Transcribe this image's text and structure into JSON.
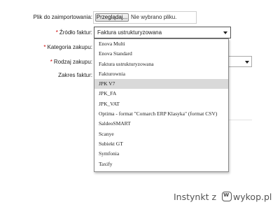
{
  "form": {
    "file_label": "Plik do zaimportowania:",
    "browse_button": "Przeglądaj...",
    "file_status": "Nie wybrano pliku.",
    "source_label": "Źródło faktur:",
    "source_value": "Faktura ustrukturyzowana",
    "category_label": "Kategoria zakupu:",
    "type_label": "Rodzaj zakupu:",
    "range_label": "Zakres faktur:",
    "required_mark": "*"
  },
  "dropdown": {
    "highlighted_index": 4,
    "options": [
      "Enova Multi",
      "Enova Standard",
      "Faktura ustrukturyzowana",
      "Fakturownia",
      "JPK V7",
      "JPK_FA",
      "JPK_VAT",
      "Optima - format \"Comarch ERP Klasyka\" (format CSV)",
      "SaldeoSMART",
      "Scanye",
      "Subiekt GT",
      "Symfonia",
      "Taxify"
    ]
  },
  "watermark": {
    "user": "Instynkt",
    "by": "z",
    "site": "wykop.pl",
    "logo_letter": "w"
  }
}
